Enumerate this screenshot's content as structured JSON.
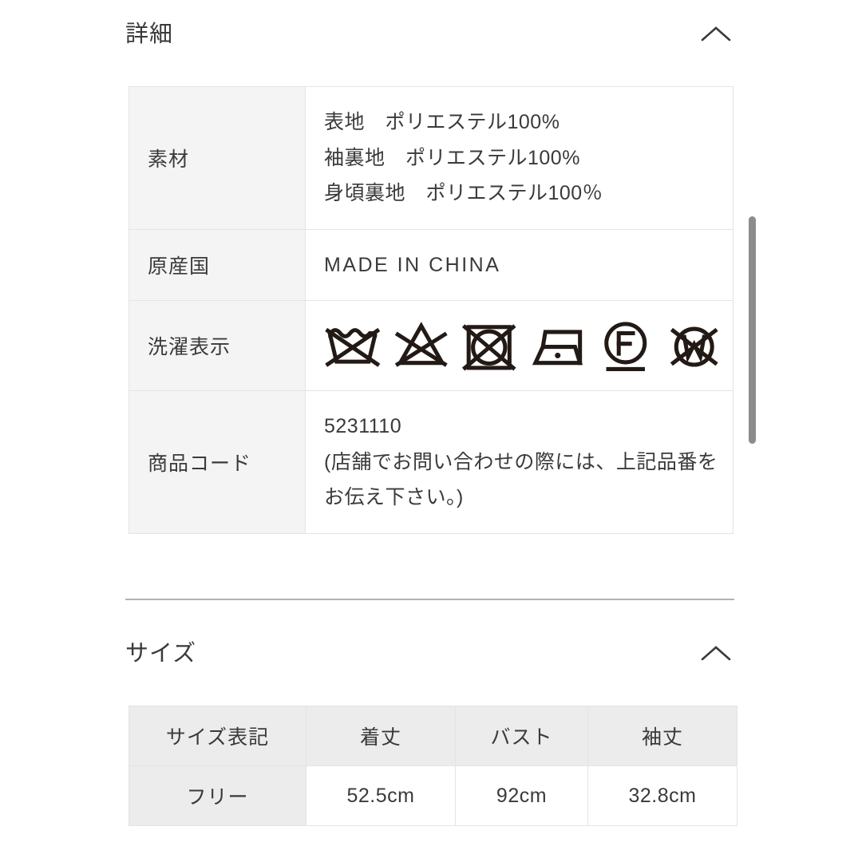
{
  "top_partial_text": "・・・・・・・",
  "detail_section": {
    "title": "詳細",
    "toggle_icon": "chevron-up-icon",
    "rows": [
      {
        "label": "素材",
        "lines": [
          "表地　ポリエステル100%",
          "袖裏地　ポリエステル100%",
          "身頃裏地　ポリエステル100％"
        ]
      },
      {
        "label": "原産国",
        "lines": [
          "MADE IN CHINA"
        ]
      },
      {
        "label": "洗濯表示",
        "care_symbols": [
          {
            "name": "do-not-wash-icon",
            "description": "水洗い不可"
          },
          {
            "name": "do-not-bleach-icon",
            "description": "漂白不可"
          },
          {
            "name": "do-not-tumble-dry-icon",
            "description": "タンブル乾燥不可"
          },
          {
            "name": "iron-low-heat-icon",
            "description": "低温アイロン"
          },
          {
            "name": "dryclean-petroleum-gentle-icon",
            "description": "石油系ドライクリーニング弱"
          },
          {
            "name": "do-not-wet-clean-icon",
            "description": "ウエットクリーニング不可"
          }
        ]
      },
      {
        "label": "商品コード",
        "lines": [
          "5231110",
          "(店舗でお問い合わせの際には、上記品番を",
          "お伝え下さい。)"
        ]
      }
    ]
  },
  "size_section": {
    "title": "サイズ",
    "toggle_icon": "chevron-up-icon",
    "table": {
      "headers": [
        "サイズ表記",
        "着丈",
        "バスト",
        "袖丈"
      ],
      "rows": [
        [
          "フリー",
          "52.5cm",
          "92cm",
          "32.8cm"
        ]
      ]
    }
  },
  "colors": {
    "text": "#3a3a3a",
    "label_bg": "#f4f4f4",
    "header_bg": "#ececec",
    "border": "#e4e4e4",
    "divider": "#b3b1b4",
    "scrollbar": "#8c8c8c"
  }
}
